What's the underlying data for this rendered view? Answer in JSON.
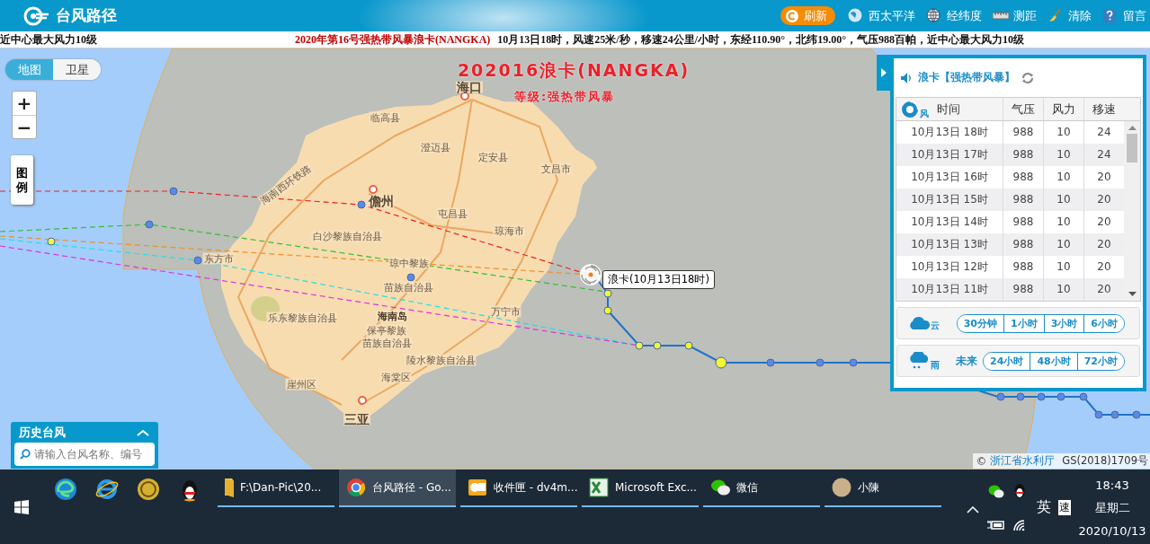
{
  "header": {
    "title": "台风路径",
    "refresh": "刷新",
    "tools": [
      {
        "label": "西太平洋",
        "kind": "globe"
      },
      {
        "label": "经纬度",
        "kind": "grid"
      },
      {
        "label": "测距",
        "kind": "ruler"
      },
      {
        "label": "清除",
        "kind": "broom"
      },
      {
        "label": "留言",
        "kind": "help"
      }
    ]
  },
  "ticker": {
    "segments": [
      {
        "text": "近中心最大风力10级",
        "kind": "plain"
      },
      {
        "text": "2020年第16号强热带风暴浪卡(NANGKA)",
        "kind": "highlight"
      },
      {
        "text": "10月13日18时，风速25米/秒，移速24公里/小时，东经110.90°，北纬19.00°，气压988百帕，近中心最大风力10级",
        "kind": "plain"
      }
    ]
  },
  "map": {
    "layer_toggle": [
      {
        "label": "地图",
        "selected": true
      },
      {
        "label": "卫星",
        "selected": false
      }
    ],
    "zoom_in": "+",
    "zoom_out": "−",
    "legend_button": "图例",
    "title": "202016浪卡(NANGKA)",
    "subtitle": "等级:强热带风暴",
    "place_labels": [
      "海口",
      "临高县",
      "澄迈县",
      "定安县",
      "文昌市",
      "海南西环铁路",
      "儋州",
      "屯昌县",
      "琼海市",
      "白沙黎族自治县",
      "东方市",
      "琼中黎族",
      "苗族自治县",
      "万宁市",
      "乐东黎族自治县",
      "海南岛",
      "保亭黎族",
      "苗族自治县",
      "陵水黎族自治县",
      "海棠区",
      "崖州区",
      "三亚"
    ],
    "typhoon_tooltip": "浪卡(10月13日18时)",
    "history_panel": {
      "title": "历史台风",
      "placeholder": "请输入台风名称、编号"
    },
    "attribution": {
      "symbol": "©",
      "link": "浙江省水利厅",
      "code": "GS(2018)1709号"
    }
  },
  "info_panel": {
    "title": "浪卡【强热带风暴】",
    "table_icon_label": "风",
    "table": {
      "columns": [
        "时间",
        "气压",
        "风力",
        "移速"
      ],
      "rows": [
        [
          "10月13日 18时",
          "988",
          "10",
          "24"
        ],
        [
          "10月13日 17时",
          "988",
          "10",
          "24"
        ],
        [
          "10月13日 16时",
          "988",
          "10",
          "20"
        ],
        [
          "10月13日 15时",
          "988",
          "10",
          "20"
        ],
        [
          "10月13日 14时",
          "988",
          "10",
          "20"
        ],
        [
          "10月13日 13时",
          "988",
          "10",
          "20"
        ],
        [
          "10月13日 12时",
          "988",
          "10",
          "20"
        ],
        [
          "10月13日 11时",
          "988",
          "10",
          "20"
        ]
      ]
    },
    "cloud": {
      "icon_label": "云",
      "buttons": [
        "30分钟",
        "1小时",
        "3小时",
        "6小时"
      ]
    },
    "rain": {
      "icon_label": "雨",
      "label": "未来",
      "buttons": [
        "24小时",
        "48小时",
        "72小时"
      ]
    }
  },
  "taskbar": {
    "tasks": [
      {
        "label": "F:\\Dan-Pic\\20...",
        "kind": "folder",
        "selected": false
      },
      {
        "label": "台风路径 - Go...",
        "kind": "browser",
        "selected": true
      },
      {
        "label": "收件匣 - dv4m...",
        "kind": "mail",
        "selected": false
      },
      {
        "label": "Microsoft Exc...",
        "kind": "excel",
        "selected": false
      },
      {
        "label": "微信",
        "kind": "chat",
        "selected": false
      },
      {
        "label": "小陳",
        "kind": "avatar",
        "selected": false
      }
    ],
    "ime": "英",
    "ime_mode": "速",
    "time": "18:43",
    "weekday": "星期二",
    "date": "2020/10/13"
  }
}
